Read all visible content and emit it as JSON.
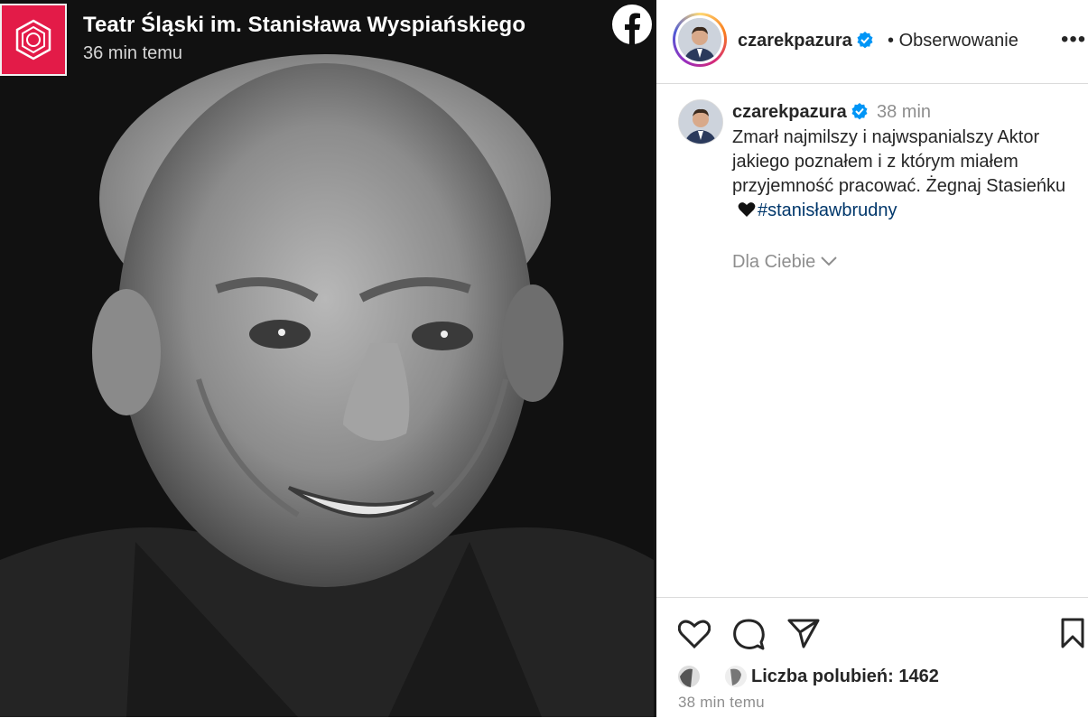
{
  "facebook_post": {
    "page_name": "Teatr Śląski im. Stanisława Wyspiańskiego",
    "time": "36 min temu",
    "logo_color": "#e31b48"
  },
  "instagram": {
    "header": {
      "username": "czarekpazura",
      "follow_status": "Obserwowanie",
      "more_icon": "more-icon"
    },
    "comment": {
      "username": "czarekpazura",
      "time": "38 min",
      "text": "Zmarł najmilszy i najwspanialszy Aktor jakiego poznałem i z którym miałem przyjemność pracować. Żegnaj Stasieńku",
      "emoji": "black-heart",
      "hashtag": "#stanisławbrudny"
    },
    "translate_label": "Dla Ciebie",
    "likes_label": "Liczba polubień: 1462",
    "post_time": "38 min temu",
    "colors": {
      "verified": "#0095f6",
      "hashtag": "#00376b",
      "muted": "#8e8e8e"
    }
  }
}
